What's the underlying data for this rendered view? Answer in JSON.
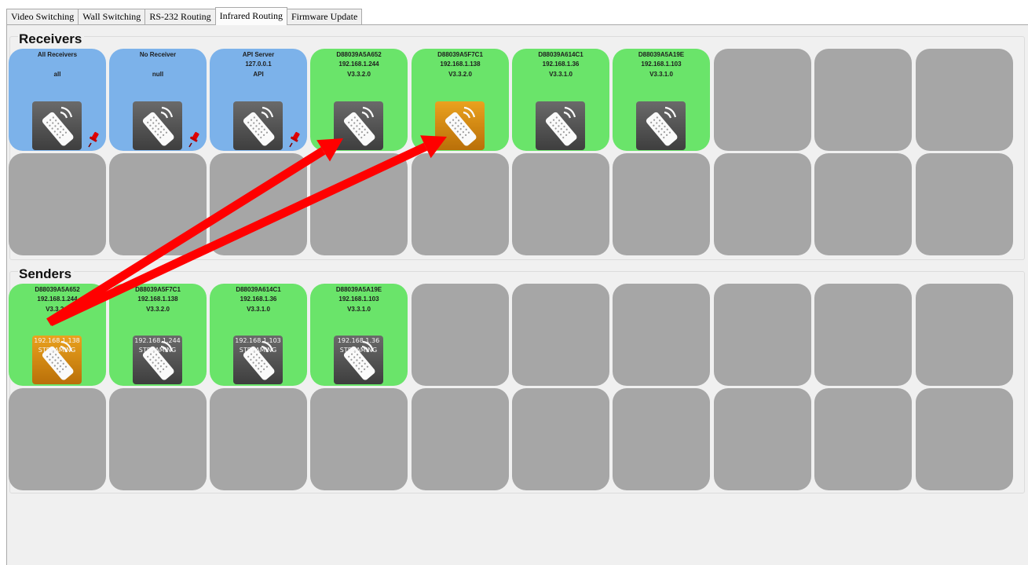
{
  "tabs": [
    "Video Switching",
    "Wall Switching",
    "RS-232 Routing",
    "Infrared Routing",
    "Firmware Update"
  ],
  "active_tab": "Infrared Routing",
  "receivers": {
    "title": "Receivers",
    "devices": [
      {
        "line1": "All Receivers",
        "line2": "",
        "line3": "all",
        "style": "blue",
        "icon": "remote-control-icon",
        "pinned": true
      },
      {
        "line1": "No Receiver",
        "line2": "",
        "line3": "null",
        "style": "blue",
        "icon": "remote-control-icon",
        "pinned": true
      },
      {
        "line1": "API Server",
        "line2": "127.0.0.1",
        "line3": "API",
        "style": "blue",
        "icon": "remote-control-icon",
        "pinned": true
      },
      {
        "line1": "D88039A5A652",
        "line2": "192.168.1.244",
        "line3": "V3.3.2.0",
        "style": "green",
        "icon": "remote-control-icon"
      },
      {
        "line1": "D88039A5F7C1",
        "line2": "192.168.1.138",
        "line3": "V3.3.2.0",
        "style": "green",
        "icon": "remote-control-icon",
        "highlight": true
      },
      {
        "line1": "D88039A614C1",
        "line2": "192.168.1.36",
        "line3": "V3.3.1.0",
        "style": "green",
        "icon": "remote-control-icon"
      },
      {
        "line1": "D88039A5A19E",
        "line2": "192.168.1.103",
        "line3": "V3.3.1.0",
        "style": "green",
        "icon": "remote-control-icon"
      }
    ]
  },
  "senders": {
    "title": "Senders",
    "devices": [
      {
        "line1": "D88039A5A652",
        "line2": "192.168.1.244",
        "line3": "V3.3.2.0",
        "style": "green",
        "icon": "remote-control-icon",
        "target": "192.168.1.138",
        "status": "STREAMING",
        "highlight": true
      },
      {
        "line1": "D88039A5F7C1",
        "line2": "192.168.1.138",
        "line3": "V3.3.2.0",
        "style": "green",
        "icon": "remote-control-icon",
        "target": "192.168.1.244",
        "status": "STREAMING"
      },
      {
        "line1": "D88039A614C1",
        "line2": "192.168.1.36",
        "line3": "V3.3.1.0",
        "style": "green",
        "icon": "remote-control-icon",
        "target": "192.168.1.103",
        "status": "STREAMING"
      },
      {
        "line1": "D88039A5A19E",
        "line2": "192.168.1.103",
        "line3": "V3.3.1.0",
        "style": "green",
        "icon": "remote-control-icon",
        "target": "192.168.1.36",
        "status": "STREAMING"
      }
    ]
  },
  "colors": {
    "receiver_system": "#7cb2ea",
    "online": "#6ae46a",
    "empty_slot": "#a6a6a6",
    "selected_icon": "#d98b12",
    "arrow": "#ff0000"
  },
  "annotation": "red-arrow-icon"
}
